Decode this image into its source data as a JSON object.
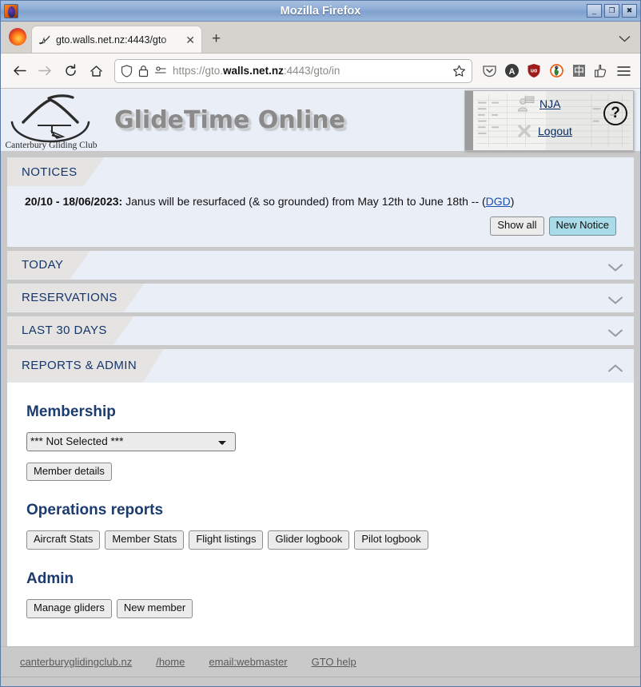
{
  "window": {
    "title": "Mozilla Firefox",
    "minimize": "_",
    "maximize": "❐",
    "close": "✖"
  },
  "browser": {
    "tab": {
      "title": "gto.walls.net.nz:4443/gto",
      "close": "✕"
    },
    "new_tab": "+",
    "tab_list_chevron": "⌄",
    "nav": {
      "back": "←",
      "forward": "→",
      "reload": "⟳",
      "home": "⌂"
    },
    "url": {
      "scheme": "https://gto.",
      "host": "walls.net.nz",
      "rest": ":4443/gto/in",
      "full": "https://gto.walls.net.nz:4443/gto/in"
    },
    "extensions": [
      "pocket-icon",
      "a-circle-icon",
      "ublock-shield-icon",
      "duckduckgo-icon",
      "chinese-char-icon",
      "hand-icon"
    ],
    "menu": "≡"
  },
  "site": {
    "brand": "GlideTime Online",
    "logo_caption": "Canterbury Gliding Club",
    "user": "NJA",
    "logout": "Logout",
    "help": "?"
  },
  "notices": {
    "label": "NOTICES",
    "date_range": "20/10 - 18/06/2023:",
    "text": " Janus will be resurfaced (& so grounded) from May 12th to June 18th -- (",
    "author": "DGD",
    "text_end": ")",
    "show_all": "Show all",
    "new_notice": "New Notice"
  },
  "sections": [
    {
      "label": "TODAY",
      "expanded": false,
      "chevron": "down"
    },
    {
      "label": "RESERVATIONS",
      "expanded": false,
      "chevron": "down"
    },
    {
      "label": "LAST 30 DAYS",
      "expanded": false,
      "chevron": "down"
    }
  ],
  "reports": {
    "label": "REPORTS & ADMIN",
    "chevron": "up",
    "membership": {
      "title": "Membership",
      "select_value": "*** Not Selected ***",
      "options": [
        "*** Not Selected ***"
      ],
      "member_details": "Member details"
    },
    "operations": {
      "title": "Operations reports",
      "buttons": [
        "Aircraft Stats",
        "Member Stats",
        "Flight listings",
        "Glider logbook",
        "Pilot logbook"
      ]
    },
    "admin": {
      "title": "Admin",
      "buttons": [
        "Manage gliders",
        "New member"
      ]
    }
  },
  "footer": {
    "links": [
      "canterburyglidingclub.nz",
      "/home",
      "email:webmaster",
      "GTO help"
    ]
  },
  "colors": {
    "panel_bg": "#e9eef7",
    "tab_bg": "#e5e4e2",
    "heading": "#1c3b6e",
    "accent_button": "#a9dbe8",
    "page_bg": "#c9c9c9",
    "link": "#1a4fb4"
  }
}
